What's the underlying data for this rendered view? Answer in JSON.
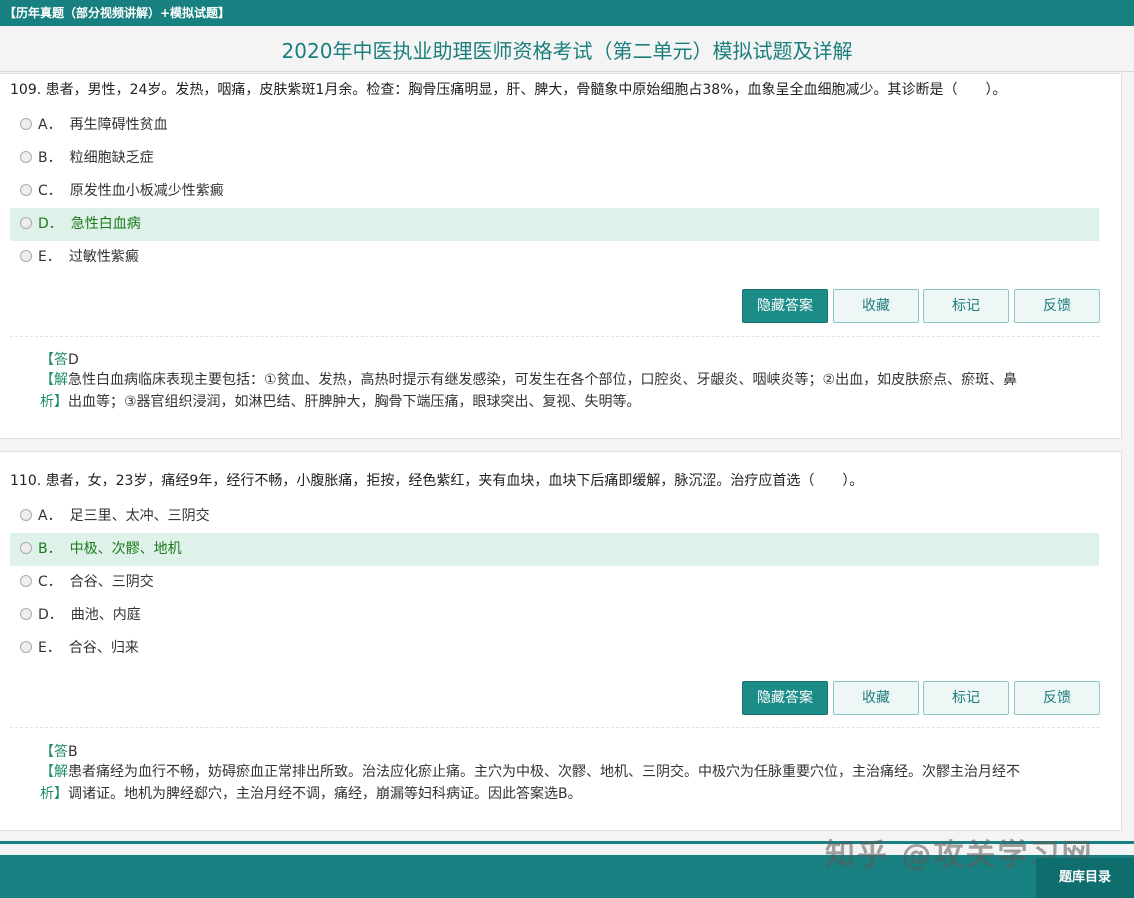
{
  "topbar": {
    "label": "【历年真题（部分视频讲解）+模拟试题】"
  },
  "page_title": "2020年中医执业助理医师资格考试（第二单元）模拟试题及详解",
  "questions": [
    {
      "text": "109. 患者，男性，24岁。发热，咽痛，皮肤紫斑1月余。检查：胸骨压痛明显，肝、脾大，骨髓象中原始细胞占38%，血象呈全血细胞减少。其诊断是（　　）。",
      "options": [
        {
          "letter": "A．",
          "text": "再生障碍性贫血"
        },
        {
          "letter": "B．",
          "text": "粒细胞缺乏症"
        },
        {
          "letter": "C．",
          "text": "原发性血小板减少性紫癜"
        },
        {
          "letter": "D．",
          "text": "急性白血病"
        },
        {
          "letter": "E．",
          "text": "过敏性紫癜"
        }
      ],
      "correct": "D",
      "buttons": {
        "hide": "隐藏答案",
        "fav": "收藏",
        "mark": "标记",
        "feedback": "反馈"
      },
      "answer_label": "【答",
      "answer_tail": "D",
      "expl_open": "【解",
      "expl_close": "析】",
      "expl_line1": "急性白血病临床表现主要包括：①贫血、发热，高热时提示有继发感染，可发生在各个部位，口腔炎、牙龈炎、咽峡炎等；②出血，如皮肤瘀点、瘀斑、鼻",
      "expl_line2": "出血等；③器官组织浸润，如淋巴结、肝脾肿大，胸骨下端压痛，眼球突出、复视、失明等。"
    },
    {
      "text": "110. 患者，女，23岁，痛经9年，经行不畅，小腹胀痛，拒按，经色紫红，夹有血块，血块下后痛即缓解，脉沉涩。治疗应首选（　　）。",
      "options": [
        {
          "letter": "A．",
          "text": "足三里、太冲、三阴交"
        },
        {
          "letter": "B．",
          "text": "中极、次髎、地机"
        },
        {
          "letter": "C．",
          "text": "合谷、三阴交"
        },
        {
          "letter": "D．",
          "text": "曲池、内庭"
        },
        {
          "letter": "E．",
          "text": "合谷、归来"
        }
      ],
      "correct": "B",
      "buttons": {
        "hide": "隐藏答案",
        "fav": "收藏",
        "mark": "标记",
        "feedback": "反馈"
      },
      "answer_label": "【答",
      "answer_tail": "B",
      "expl_open": "【解",
      "expl_close": "析】",
      "expl_line1": "患者痛经为血行不畅，妨碍瘀血正常排出所致。治法应化瘀止痛。主穴为中极、次髎、地机、三阴交。中极穴为任脉重要穴位，主治痛经。次髎主治月经不",
      "expl_line2": "调诸证。地机为脾经郄穴，主治月经不调，痛经，崩漏等妇科病证。因此答案选B。"
    }
  ],
  "footer": {
    "toc_label": "题库目录"
  },
  "watermark": "知乎 @攻关学习网",
  "colors": {
    "brand": "#188080",
    "correct_bg": "#dff2ea",
    "correct_text": "#1c7a1c"
  }
}
